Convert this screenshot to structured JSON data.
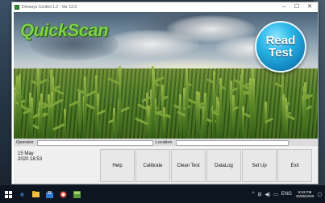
{
  "window": {
    "title": "Drivesys Control 1.2 - Ver 12.3",
    "minimize": "–",
    "maximize": "☐",
    "close": "✕"
  },
  "banner": {
    "logo_text": "QuickScan",
    "read_test_line1": "Read",
    "read_test_line2": "Test"
  },
  "info": {
    "operator_label": "Operator",
    "operator_value": "",
    "location_label": "Location",
    "location_value": ""
  },
  "status": {
    "date": "15 May",
    "datetime": "2020 18:53"
  },
  "buttons": [
    {
      "label": "Help"
    },
    {
      "label": "Calibrate"
    },
    {
      "label": "Clean Test"
    },
    {
      "label": "DataLog"
    },
    {
      "label": "Set Up"
    },
    {
      "label": "Exit"
    }
  ],
  "taskbar": {
    "clock_time": "6:53 PM",
    "clock_date": "15/05/2020",
    "language": "ENG"
  },
  "colors": {
    "logo": "#7fd14a",
    "read_button": "#2cb8e8",
    "taskbar": "#0d1620"
  }
}
